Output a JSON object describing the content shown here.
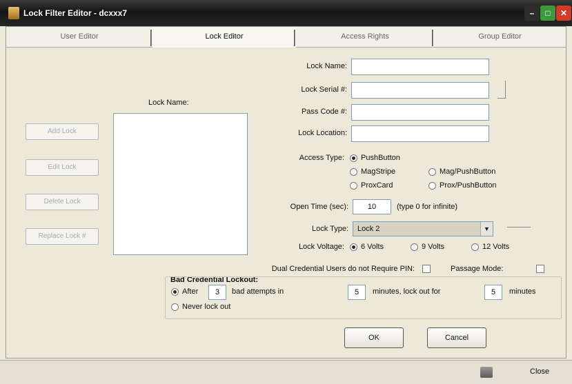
{
  "window": {
    "title": "Lock Filter Editor - dcxxx7",
    "min_glyph": "–",
    "max_glyph": "□",
    "close_glyph": "✕"
  },
  "tabs": [
    {
      "label": "User Editor",
      "active": false
    },
    {
      "label": "Lock Editor",
      "active": true
    },
    {
      "label": "Access Rights",
      "active": false
    },
    {
      "label": "Group Editor",
      "active": false
    }
  ],
  "lock_names": {
    "label": "Lock Name:",
    "items": []
  },
  "side_buttons": [
    "Add Lock",
    "Edit Lock",
    "Delete Lock",
    "Replace Lock #"
  ],
  "form": {
    "lock_name_label": "Lock Name:",
    "lock_name_value": "",
    "serial_label": "Lock Serial #:",
    "serial_value": "",
    "pass_code_label": "Pass Code #:",
    "pass_code_value": "",
    "location_label": "Lock Location:",
    "location_value": ""
  },
  "access_type": {
    "label": "Access Type:",
    "options": [
      "PushButton",
      "MagStripe",
      "Mag/PushButton",
      "ProxCard",
      "Prox/PushButton"
    ],
    "selected": "PushButton"
  },
  "open_time": {
    "label": "Open Time (sec):",
    "value": "10",
    "hint": "(type 0 for infinite)"
  },
  "lock_type": {
    "label": "Lock Type:",
    "value": "Lock 2",
    "arrow": "▼"
  },
  "lock_voltage": {
    "label": "Lock Voltage:",
    "options": [
      "6 Volts",
      "9 Volts",
      "12 Volts"
    ],
    "selected": "6 Volts"
  },
  "dual_credential": {
    "label": "Dual Credential Users do not Require PIN:",
    "passage_label": "Passage Mode:"
  },
  "lockout": {
    "label": "Bad Credential Lockout:",
    "after_label": "After",
    "attempts_value": "3",
    "attempts_text": "bad attempts in",
    "minutes_value": "5",
    "lockout_text": "minutes, lock out for",
    "lockout_value": "5",
    "minutes_label": "minutes",
    "never_label": "Never lock out",
    "selected": "after"
  },
  "buttons": {
    "ok": "OK",
    "cancel": "Cancel"
  },
  "statusbar": {
    "close": "Close"
  }
}
